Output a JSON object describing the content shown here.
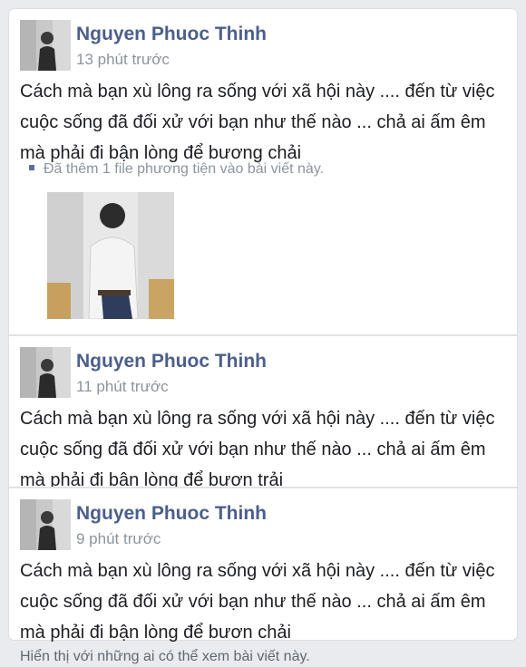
{
  "posts": [
    {
      "author": "Nguyen Phuoc Thinh",
      "time": "13 phút trước",
      "text": "Cách mà bạn xù lông ra sống với xã hội này .... đến từ việc cuộc sống đã đối xử với bạn như thế nào ... chả ai ấm êm mà phải đi bận lòng để bương chải",
      "attachment_note": "Đã thêm 1 file phương tiện vào bài viết này."
    },
    {
      "author": "Nguyen Phuoc Thinh",
      "time": "11 phút trước",
      "text": "Cách mà bạn xù lông ra sống với xã hội này .... đến từ việc cuộc sống đã đối xử với bạn như thế nào ... chả ai ấm êm mà phải đi bận lòng để bươn trải"
    },
    {
      "author": "Nguyen Phuoc Thinh",
      "time": "9 phút trước",
      "text": "Cách mà bạn xù lông ra sống với xã hội này .... đến từ việc cuộc sống đã đối xử với bạn như thế nào ... chả ai ấm êm mà phải đi bận lòng để bươn chải"
    }
  ],
  "footer_text": "Hiển thị với những ai có thể xem bài viết này.",
  "colors": {
    "author": "#4b5f8c",
    "meta": "#8d949e",
    "text": "#1c1e21",
    "background": "#e9ebee"
  }
}
